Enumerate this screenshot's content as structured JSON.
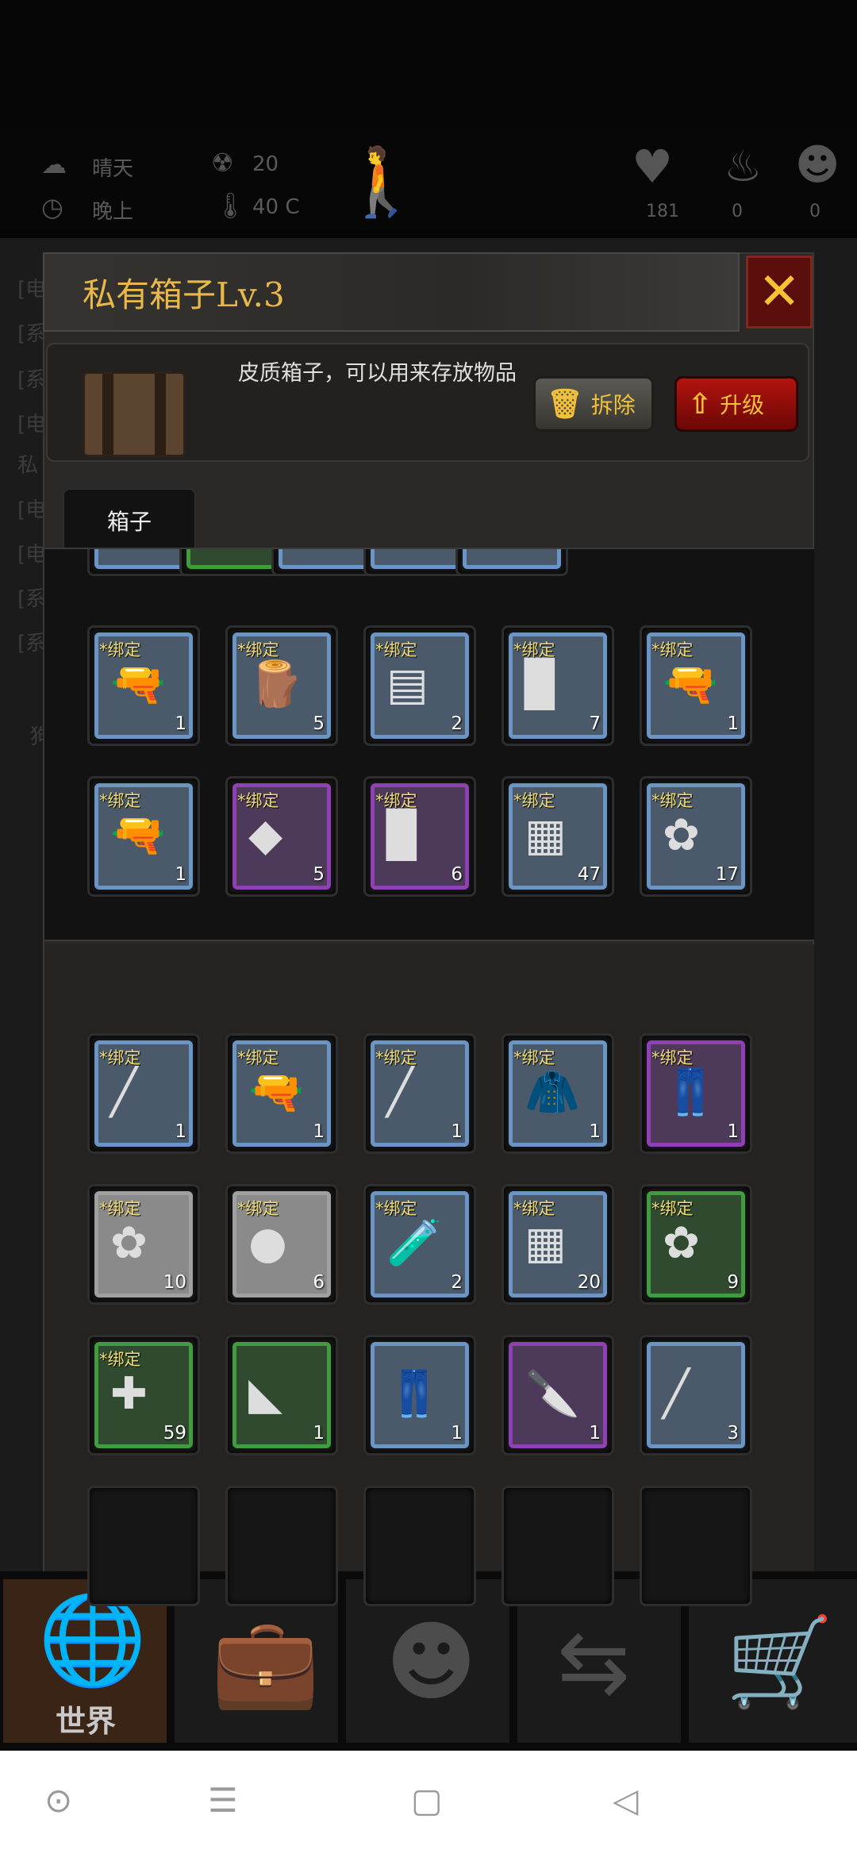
{
  "hud": {
    "weather": "晴天",
    "time_of_day": "晚上",
    "radiation": "20",
    "temperature": "40 C",
    "health": "181",
    "stat_2": "0",
    "stat_3": "0"
  },
  "log_lines": [
    "[电",
    "[系",
    "[系",
    "[电",
    "私",
    "[电",
    "[电",
    "[系",
    "[系",
    "狗"
  ],
  "dialog": {
    "title": "私有箱子Lv.3",
    "description": "皮质箱子，可以用来存放物品",
    "dismantle_label": "拆除",
    "upgrade_label": "升级",
    "tab_label": "箱子"
  },
  "box_items": [
    {
      "tag": "*绑定",
      "count": "1",
      "icon": "shotgun-icon",
      "quality": "blue",
      "glyph": "🔫"
    },
    {
      "tag": "*绑定",
      "count": "5",
      "icon": "firewood-icon",
      "quality": "blue",
      "glyph": "🪵"
    },
    {
      "tag": "*绑定",
      "count": "2",
      "icon": "metal-plates-icon",
      "quality": "blue",
      "glyph": "▤"
    },
    {
      "tag": "*绑定",
      "count": "7",
      "icon": "wood-block-icon",
      "quality": "blue",
      "glyph": "▉"
    },
    {
      "tag": "*绑定",
      "count": "1",
      "icon": "pistol-icon",
      "quality": "blue",
      "glyph": "🔫"
    },
    {
      "tag": "*绑定",
      "count": "1",
      "icon": "pistol-icon",
      "quality": "blue",
      "glyph": "🔫"
    },
    {
      "tag": "*绑定",
      "count": "5",
      "icon": "gold-nugget-icon",
      "quality": "purple",
      "glyph": "◆"
    },
    {
      "tag": "*绑定",
      "count": "6",
      "icon": "wood-block-icon",
      "quality": "purple",
      "glyph": "▉"
    },
    {
      "tag": "*绑定",
      "count": "47",
      "icon": "ammo-box-icon",
      "quality": "blue",
      "glyph": "▦"
    },
    {
      "tag": "*绑定",
      "count": "17",
      "icon": "herb-leaf-icon",
      "quality": "blue",
      "glyph": "✿"
    }
  ],
  "bag_items": [
    {
      "tag": "*绑定",
      "count": "1",
      "icon": "steel-rod-icon",
      "quality": "blue",
      "glyph": "╱"
    },
    {
      "tag": "*绑定",
      "count": "1",
      "icon": "submachine-gun-icon",
      "quality": "blue",
      "glyph": "🔫"
    },
    {
      "tag": "*绑定",
      "count": "1",
      "icon": "rifle-icon",
      "quality": "blue",
      "glyph": "╱"
    },
    {
      "tag": "*绑定",
      "count": "1",
      "icon": "leather-coat-icon",
      "quality": "blue",
      "glyph": "🧥"
    },
    {
      "tag": "*绑定",
      "count": "1",
      "icon": "yellow-pants-icon",
      "quality": "purple",
      "glyph": "👖"
    },
    {
      "tag": "*绑定",
      "count": "10",
      "icon": "grass-icon",
      "quality": "white",
      "glyph": "✿"
    },
    {
      "tag": "*绑定",
      "count": "6",
      "icon": "dung-icon",
      "quality": "white",
      "glyph": "●"
    },
    {
      "tag": "*绑定",
      "count": "2",
      "icon": "blood-test-tube-icon",
      "quality": "blue",
      "glyph": "🧪"
    },
    {
      "tag": "*绑定",
      "count": "20",
      "icon": "ammo-box-icon",
      "quality": "blue",
      "glyph": "▦"
    },
    {
      "tag": "*绑定",
      "count": "9",
      "icon": "herb-leaf-icon",
      "quality": "green",
      "glyph": "✿"
    },
    {
      "tag": "*绑定",
      "count": "59",
      "icon": "bandage-icon",
      "quality": "green",
      "glyph": "✚"
    },
    {
      "tag": "",
      "count": "1",
      "icon": "cloth-scrap-icon",
      "quality": "green",
      "glyph": "◣"
    },
    {
      "tag": "",
      "count": "1",
      "icon": "jeans-icon",
      "quality": "blue",
      "glyph": "👖"
    },
    {
      "tag": "",
      "count": "1",
      "icon": "machete-icon",
      "quality": "purple",
      "glyph": "🔪"
    },
    {
      "tag": "",
      "count": "3",
      "icon": "nail-icon",
      "quality": "blue",
      "glyph": "╱"
    },
    {
      "tag": "",
      "count": "",
      "icon": "empty-slot",
      "quality": "empty",
      "glyph": ""
    },
    {
      "tag": "",
      "count": "",
      "icon": "empty-slot",
      "quality": "empty",
      "glyph": ""
    },
    {
      "tag": "",
      "count": "",
      "icon": "empty-slot",
      "quality": "empty",
      "glyph": ""
    },
    {
      "tag": "",
      "count": "",
      "icon": "empty-slot",
      "quality": "empty",
      "glyph": ""
    },
    {
      "tag": "",
      "count": "",
      "icon": "empty-slot",
      "quality": "empty",
      "glyph": ""
    }
  ],
  "nav": {
    "world_label": "世界",
    "items": [
      "globe-icon",
      "backpack-icon",
      "head-gears-icon",
      "trade-icon",
      "shopping-cart-icon"
    ]
  },
  "colors": {
    "title": "#e8b84a",
    "close_bg": "#5a0f0c",
    "upgrade_bg": "#b3140e",
    "blue_frame": "#6b95c4",
    "purple_frame": "#9040b5",
    "green_frame": "#3f9c3f"
  }
}
